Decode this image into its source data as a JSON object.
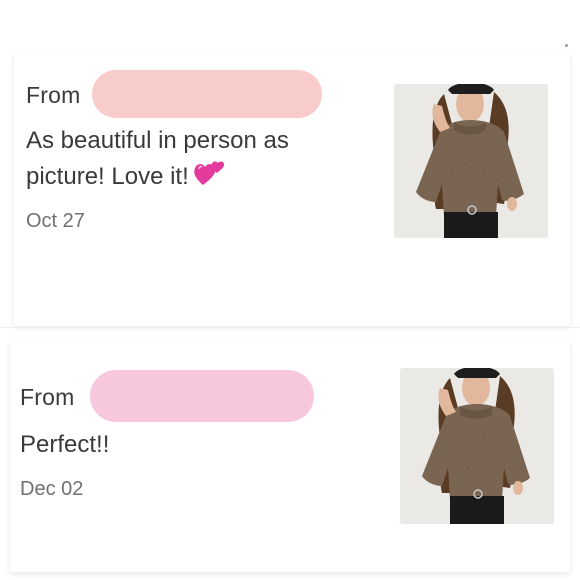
{
  "reviews": [
    {
      "from_label": "From",
      "text": "As beautiful in person as picture! Love it!",
      "emoji_icon": "two-hearts-icon",
      "date": "Oct 27",
      "redaction_color": "#f9c9c9",
      "photo_icon": "product-photo"
    },
    {
      "from_label": "From",
      "text": "Perfect!!",
      "date": "Dec 02",
      "redaction_color": "#f7c4dc",
      "photo_icon": "product-photo"
    }
  ]
}
